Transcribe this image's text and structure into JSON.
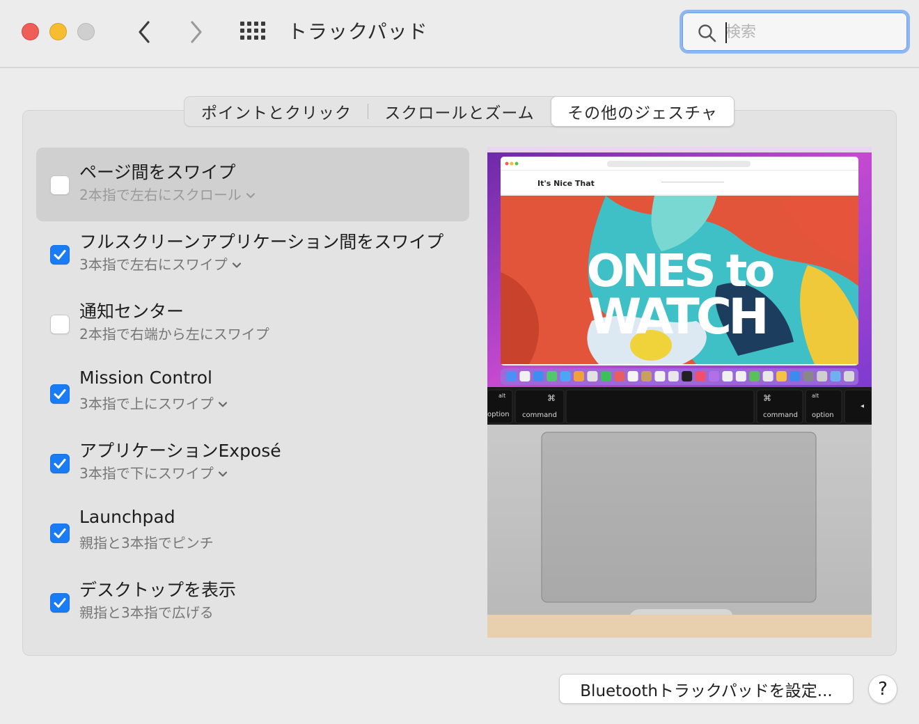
{
  "window": {
    "title": "トラックパッド",
    "traffic_lights": [
      "close",
      "minimize",
      "zoom-disabled"
    ]
  },
  "toolbar": {
    "back_icon": "chevron-left-icon",
    "forward_icon": "chevron-right-icon",
    "grid_icon": "show-all-grid-icon"
  },
  "search": {
    "placeholder": "検索",
    "value": "",
    "accent": "#8fb6ef"
  },
  "tabs": [
    {
      "label": "ポイントとクリック",
      "selected": false
    },
    {
      "label": "スクロールとズーム",
      "selected": false
    },
    {
      "label": "その他のジェスチャ",
      "selected": true
    }
  ],
  "gestures": [
    {
      "title": "ページ間をスワイプ",
      "subtitle": "2本指で左右にスクロール",
      "checked": false,
      "has_dropdown": true,
      "selected": true
    },
    {
      "title": "フルスクリーンアプリケーション間をスワイプ",
      "subtitle": "3本指で左右にスワイプ",
      "checked": true,
      "has_dropdown": true,
      "selected": false
    },
    {
      "title": "通知センター",
      "subtitle": "2本指で右端から左にスワイプ",
      "checked": false,
      "has_dropdown": false,
      "selected": false
    },
    {
      "title": "Mission Control",
      "subtitle": "3本指で上にスワイプ",
      "checked": true,
      "has_dropdown": true,
      "selected": false
    },
    {
      "title": "アプリケーションExposé",
      "subtitle": "3本指で下にスワイプ",
      "checked": true,
      "has_dropdown": true,
      "selected": false
    },
    {
      "title": "Launchpad",
      "subtitle": "親指と3本指でピンチ",
      "checked": true,
      "has_dropdown": false,
      "selected": false
    },
    {
      "title": "デスクトップを表示",
      "subtitle": "親指と3本指で広げる",
      "checked": true,
      "has_dropdown": false,
      "selected": false
    }
  ],
  "preview": {
    "site_logo": "It's Nice That",
    "hero_line1": "ONES to",
    "hero_line2": "WATCH",
    "keys": {
      "left_alt": "alt",
      "left_option": "option",
      "left_cmd_symbol": "⌘",
      "left_command": "command",
      "right_cmd_symbol": "⌘",
      "right_command": "command",
      "right_alt": "alt",
      "right_option": "option",
      "arrow": "◂"
    }
  },
  "footer": {
    "bluetooth_button": "Bluetoothトラックパッドを設定...",
    "help_button": "?"
  },
  "colors": {
    "checkbox_on": "#1a7cf5",
    "window_bg": "#ececec",
    "panel_bg": "#e3e3e3",
    "selected_row": "#d0d0d0"
  }
}
